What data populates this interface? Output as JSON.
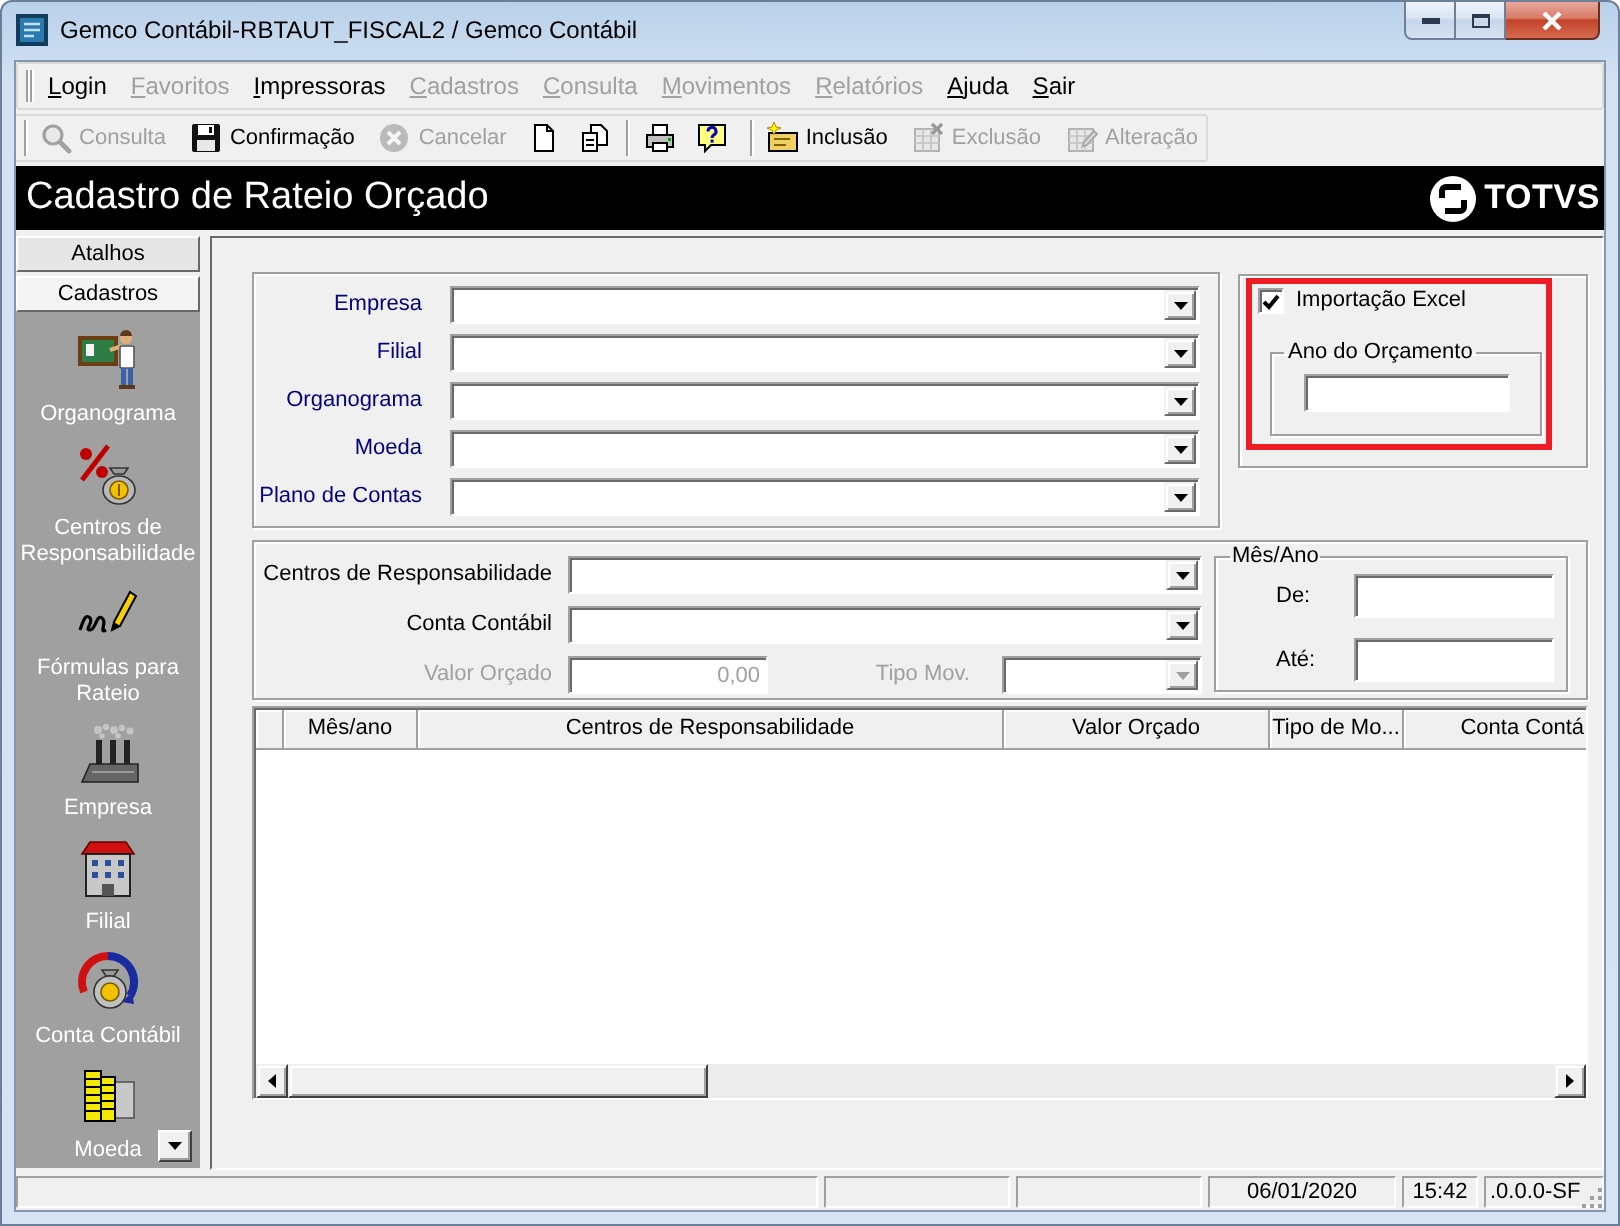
{
  "window": {
    "title": "Gemco Contábil-RBTAUT_FISCAL2 / Gemco Contábil"
  },
  "menu": [
    {
      "label": "Login",
      "disabled": false
    },
    {
      "label": "Favoritos",
      "disabled": true
    },
    {
      "label": "Impressoras",
      "disabled": false
    },
    {
      "label": "Cadastros",
      "disabled": true
    },
    {
      "label": "Consulta",
      "disabled": true
    },
    {
      "label": "Movimentos",
      "disabled": true
    },
    {
      "label": "Relatórios",
      "disabled": true
    },
    {
      "label": "Ajuda",
      "disabled": false
    },
    {
      "label": "Sair",
      "disabled": false
    }
  ],
  "toolbar": [
    {
      "kind": "grip"
    },
    {
      "kind": "button",
      "label": "Consulta",
      "disabled": true
    },
    {
      "kind": "button",
      "label": "Confirmação",
      "disabled": false
    },
    {
      "kind": "button",
      "label": "Cancelar",
      "disabled": true
    },
    {
      "kind": "icon",
      "disabled": false
    },
    {
      "kind": "icon",
      "disabled": false
    },
    {
      "kind": "separator"
    },
    {
      "kind": "icon",
      "disabled": false
    },
    {
      "kind": "icon",
      "disabled": false
    },
    {
      "kind": "grip"
    },
    {
      "kind": "button",
      "label": "Inclusão",
      "disabled": false
    },
    {
      "kind": "button",
      "label": "Exclusão",
      "disabled": true
    },
    {
      "kind": "button",
      "label": "Alteração",
      "disabled": true
    }
  ],
  "header": {
    "title": "Cadastro de Rateio Orçado",
    "logo": "TOTVS"
  },
  "sidebar": {
    "tabs": [
      {
        "label": "Atalhos",
        "selected": false
      },
      {
        "label": "Cadastros",
        "selected": true
      }
    ],
    "items": [
      {
        "label": "Organograma"
      },
      {
        "label": "Centros de Responsabilidade"
      },
      {
        "label": "Fórmulas para Rateio"
      },
      {
        "label": "Empresa"
      },
      {
        "label": "Filial"
      },
      {
        "label": "Conta Contábil"
      },
      {
        "label": "Moeda"
      }
    ]
  },
  "form": {
    "fields": [
      {
        "label": "Empresa",
        "kind": "combo",
        "required": true
      },
      {
        "label": "Filial",
        "kind": "combo",
        "required": true
      },
      {
        "label": "Organograma",
        "kind": "combo",
        "required": true
      },
      {
        "label": "Moeda",
        "kind": "combo",
        "required": true
      },
      {
        "label": "Plano de Contas",
        "kind": "combo",
        "required": true
      }
    ]
  },
  "import_excel": {
    "label": "Importação Excel",
    "checked": true,
    "highlighted": true,
    "year": {
      "title": "Ano do Orçamento"
    }
  },
  "details": {
    "rows": [
      [
        {
          "label": "Centros de Responsabilidade",
          "kind": "combo",
          "required": false,
          "disabled": false
        }
      ],
      [
        {
          "label": "Conta Contábil",
          "kind": "combo",
          "required": false,
          "disabled": false
        }
      ],
      [
        {
          "label": "Valor Orçado",
          "kind": "text",
          "value": "0,00",
          "required": false,
          "disabled": true
        },
        {
          "label": "Tipo Mov.",
          "kind": "combo",
          "required": false,
          "disabled": true
        }
      ]
    ],
    "period": {
      "title": "Mês/Ano",
      "fields": [
        {
          "label": "De:"
        },
        {
          "label": "Até:"
        }
      ]
    }
  },
  "grid": {
    "columns": [
      "Mês/ano",
      "Centros de Responsabilidade",
      "Valor Orçado",
      "Tipo de Mo...",
      "Conta Contá"
    ]
  },
  "status_bar": {
    "date": "06/01/2020",
    "time": "15:42",
    "version": ".0.0.0-SF"
  }
}
